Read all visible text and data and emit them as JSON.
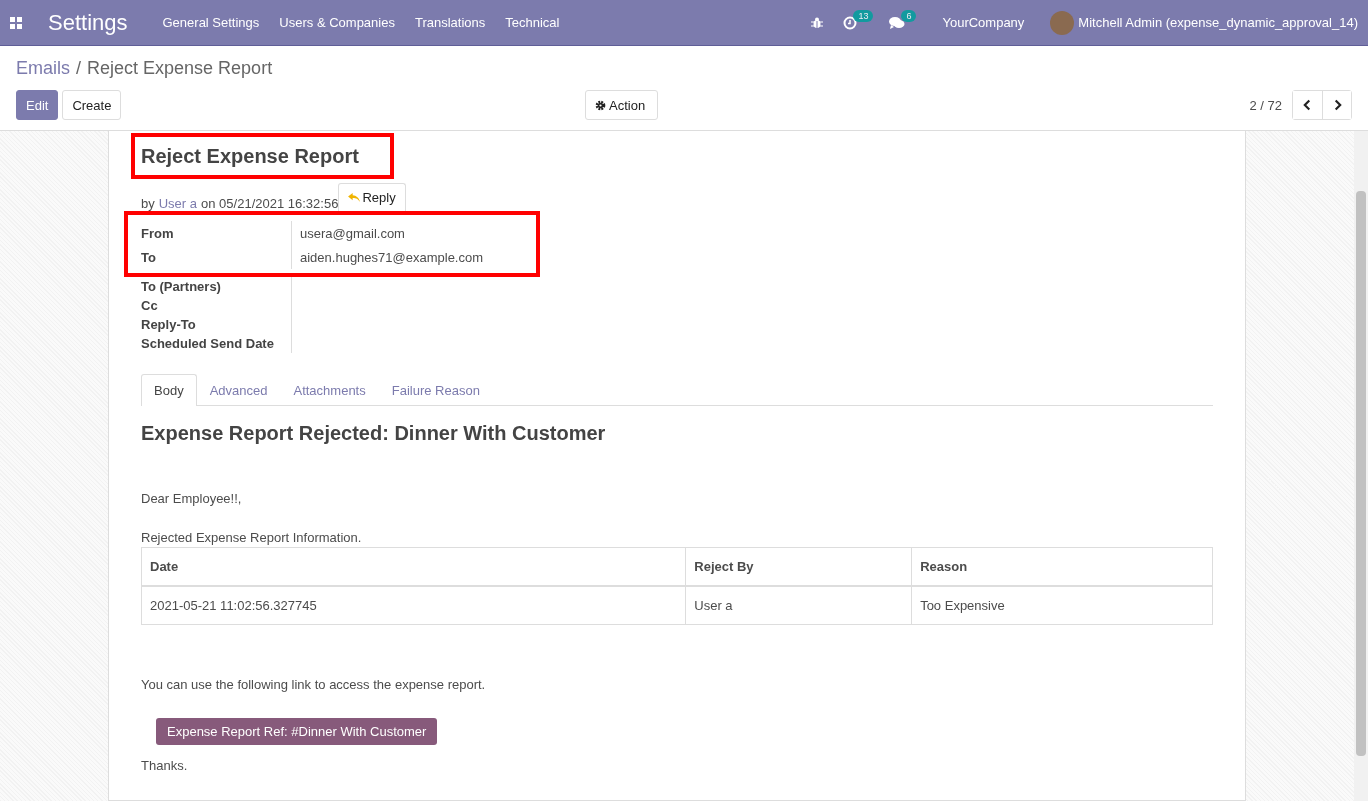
{
  "navbar": {
    "app_title": "Settings",
    "menu": [
      "General Settings",
      "Users & Companies",
      "Translations",
      "Technical"
    ],
    "activity_count": "13",
    "message_count": "6",
    "company": "YourCompany",
    "user": "Mitchell Admin (expense_dynamic_approval_14)"
  },
  "breadcrumb": {
    "parent": "Emails",
    "separator": "/",
    "current": "Reject Expense Report"
  },
  "buttons": {
    "edit": "Edit",
    "create": "Create",
    "action": "Action"
  },
  "pager": {
    "value": "2 / 72"
  },
  "record": {
    "subject": "Reject Expense Report",
    "by": "by",
    "author": "User a",
    "date": "on 05/21/2021 16:32:56",
    "reply": "Reply",
    "highlighted_fields": [
      {
        "label": "From",
        "value": "usera@gmail.com"
      },
      {
        "label": "To",
        "value": "aiden.hughes71@example.com"
      }
    ],
    "fields": [
      {
        "label": "To (Partners)"
      },
      {
        "label": "Cc"
      },
      {
        "label": "Reply-To"
      },
      {
        "label": "Scheduled Send Date"
      }
    ]
  },
  "tabs": [
    {
      "label": "Body",
      "selected": true
    },
    {
      "label": "Advanced",
      "selected": false
    },
    {
      "label": "Attachments",
      "selected": false
    },
    {
      "label": "Failure Reason",
      "selected": false
    }
  ],
  "body": {
    "heading": "Expense Report Rejected: Dinner With Customer",
    "greeting": "Dear Employee!!,",
    "intro": "Rejected Expense Report Information.",
    "table": {
      "columns": [
        "Date",
        "Reject By",
        "Reason"
      ],
      "rows": [
        [
          "2021-05-21 11:02:56.327745",
          "User a",
          "Too Expensive"
        ]
      ]
    },
    "link_text": "You can use the following link to access the expense report.",
    "link_button": "Expense Report Ref: #Dinner With Customer",
    "closing": "Thanks."
  }
}
